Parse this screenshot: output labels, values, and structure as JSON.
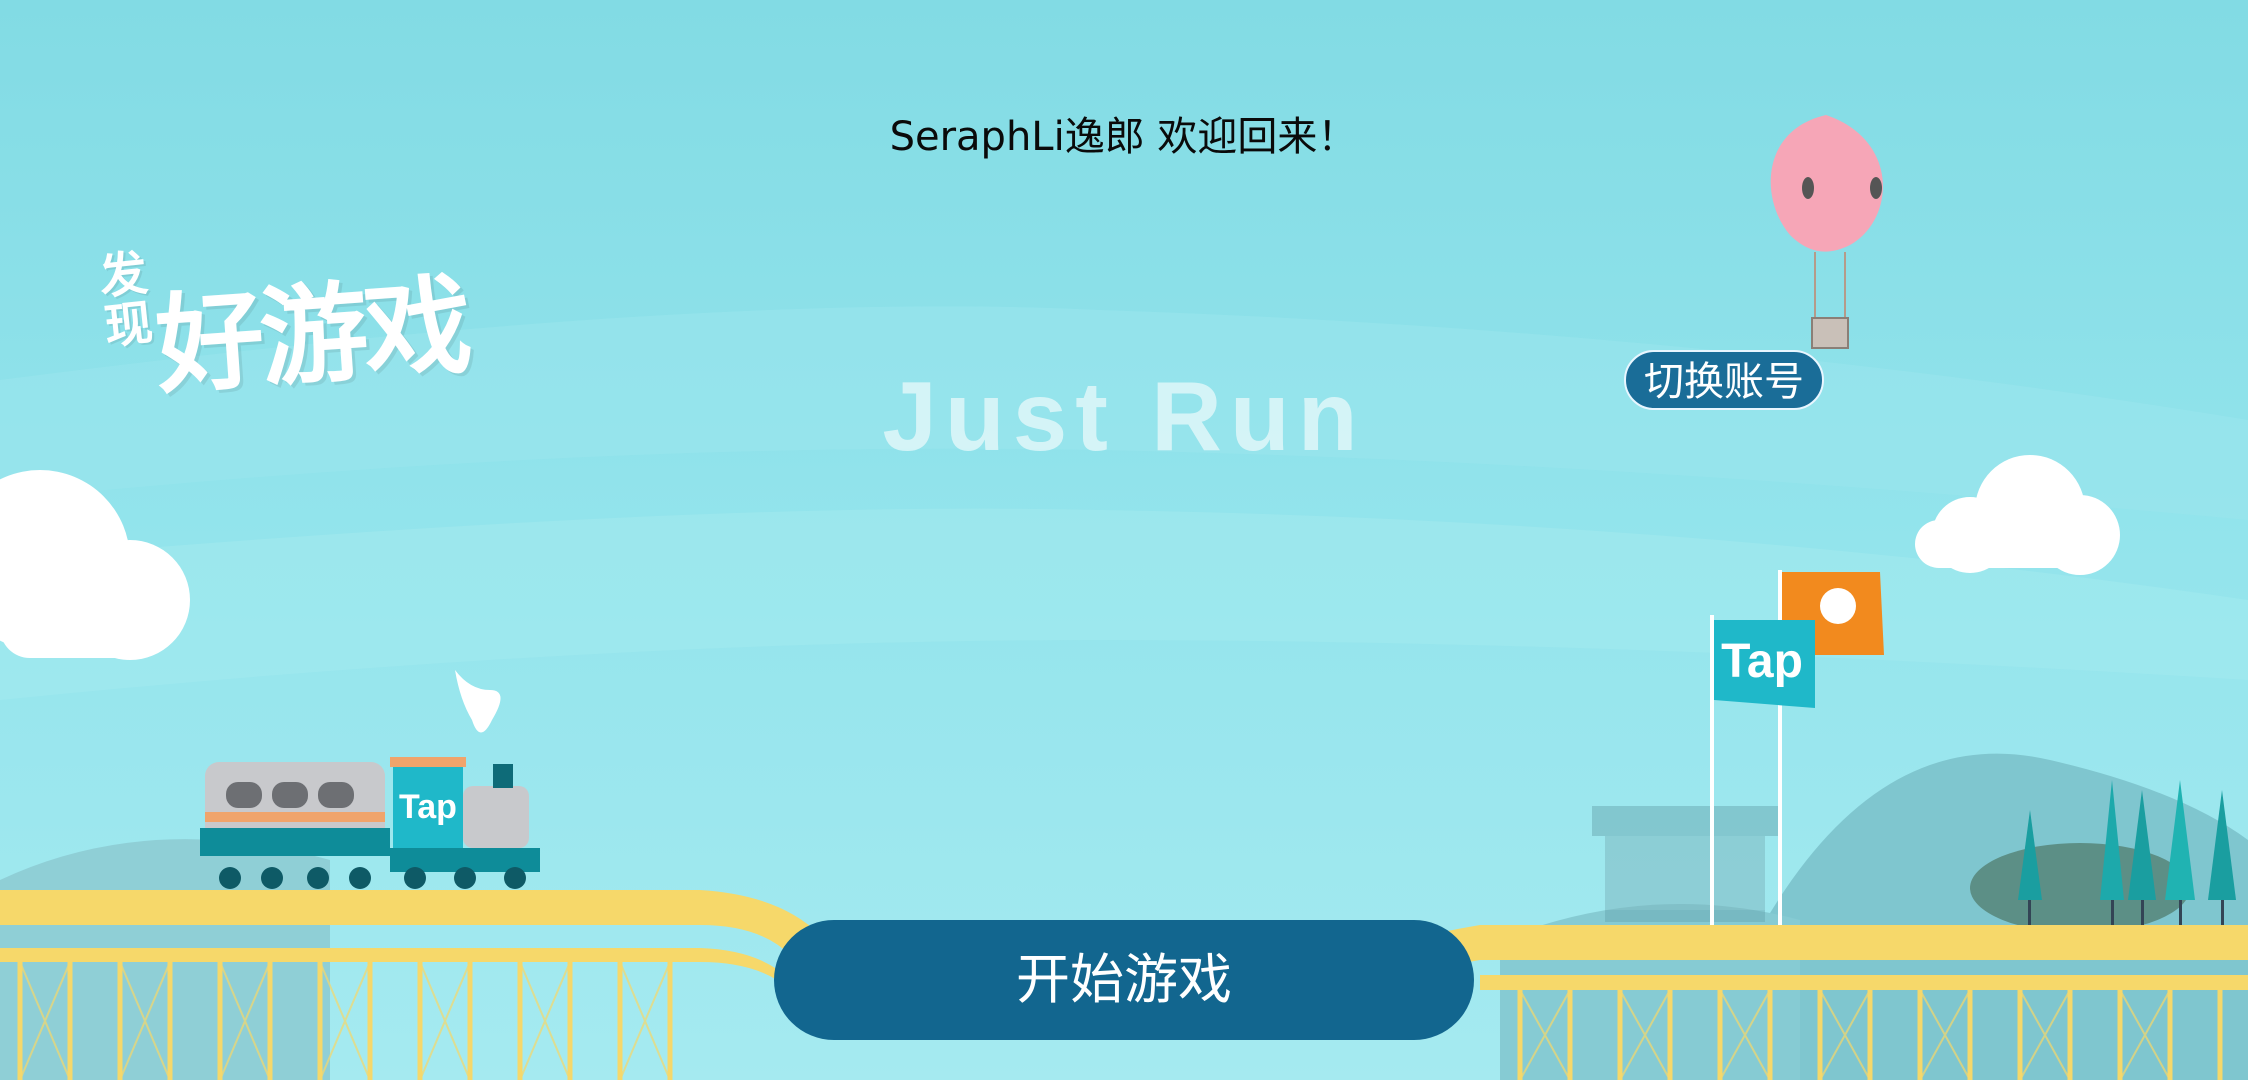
{
  "welcome": {
    "text": "SeraphLi逸郎 欢迎回来！"
  },
  "game": {
    "title": "Just Run"
  },
  "buttons": {
    "switch_account": "切换账号",
    "start_game": "开始游戏"
  },
  "banner": {
    "slogan_small": "发现",
    "slogan_big": "好游戏"
  },
  "brand": {
    "tap_label": "Tap"
  },
  "colors": {
    "sky": "#86dfe7",
    "button": "#12668f",
    "track": "#f6d86a",
    "balloon": "#f6a6b7",
    "flag_teal": "#1fb8c9",
    "flag_orange": "#f28a1e"
  }
}
